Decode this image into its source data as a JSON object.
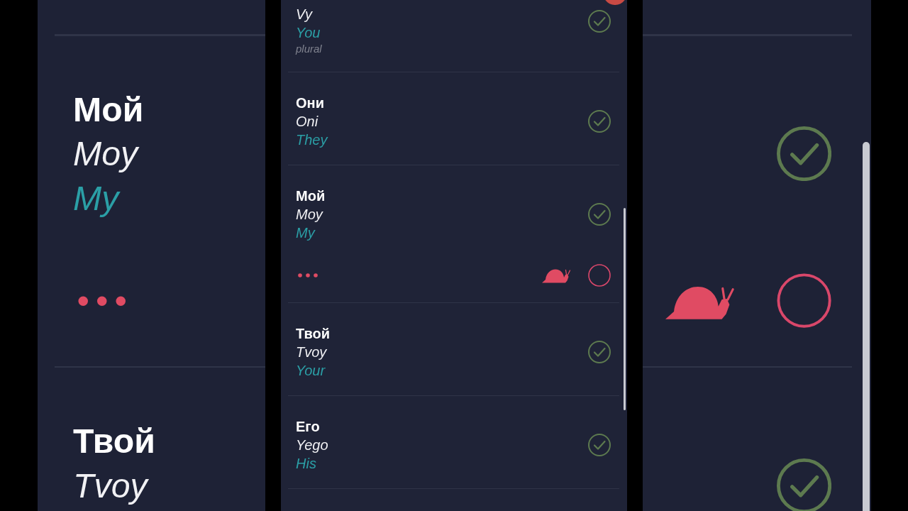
{
  "backdrop": {
    "rows": [
      {
        "word": "Мой",
        "transliteration": "Moy",
        "translation": "My",
        "learned": true,
        "expanded": true
      },
      {
        "word": "Твой",
        "transliteration": "Tvoy",
        "learned": true,
        "expanded": false
      }
    ]
  },
  "list": {
    "rows": [
      {
        "transliteration": "Vy",
        "translation": "You",
        "note": "plural",
        "learned": true,
        "expanded": false
      },
      {
        "word": "Они",
        "transliteration": "Oni",
        "translation": "They",
        "learned": true,
        "expanded": false
      },
      {
        "word": "Мой",
        "transliteration": "Moy",
        "translation": "My",
        "learned": true,
        "expanded": true
      },
      {
        "word": "Твой",
        "transliteration": "Tvoy",
        "translation": "Your",
        "learned": true,
        "expanded": false
      },
      {
        "word": "Его",
        "transliteration": "Yego",
        "translation": "His",
        "learned": true,
        "expanded": false
      }
    ]
  }
}
